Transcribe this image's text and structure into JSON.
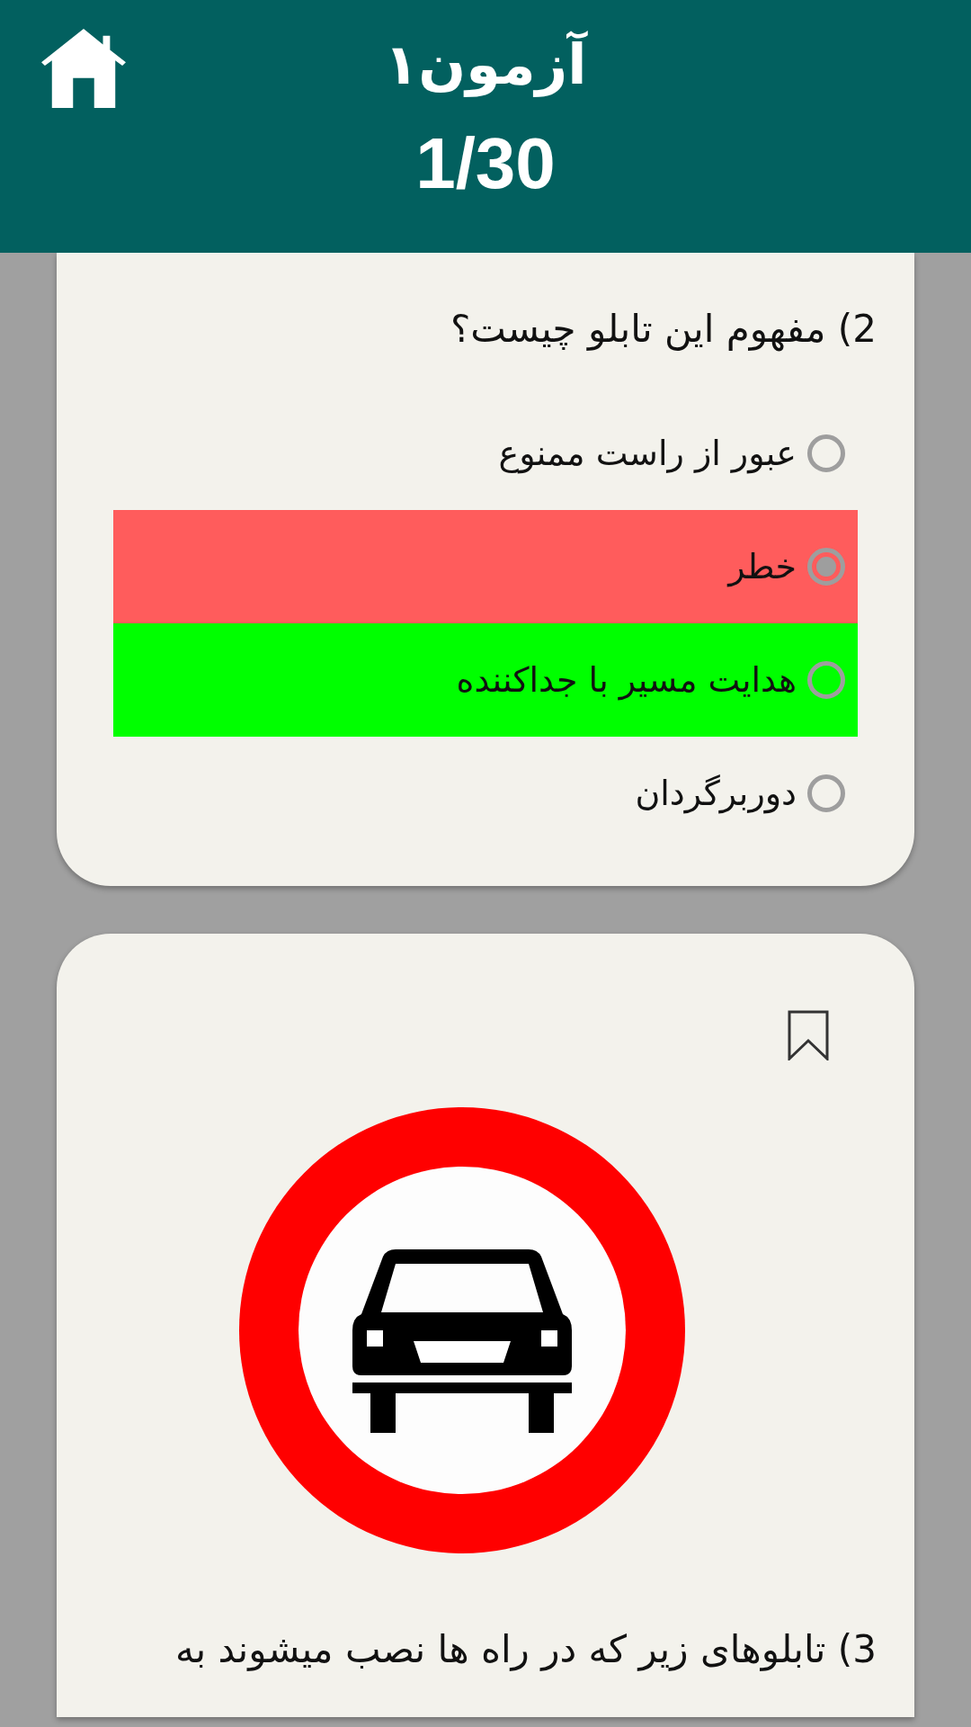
{
  "header": {
    "title": "آزمون۱",
    "counter": "1/30"
  },
  "questions": [
    {
      "text": "2) مفهوم این تابلو چیست؟",
      "options": [
        {
          "label": "عبور از راست ممنوع",
          "selected": false,
          "correct": false
        },
        {
          "label": "خطر",
          "selected": true,
          "correct": false
        },
        {
          "label": "هدایت مسیر با جداکننده",
          "selected": false,
          "correct": true
        },
        {
          "label": "دوربرگردان",
          "selected": false,
          "correct": false
        }
      ]
    },
    {
      "bookmarked": false,
      "text": "3) تابلوهای زیر که در راه ها نصب میشوند به"
    }
  ]
}
